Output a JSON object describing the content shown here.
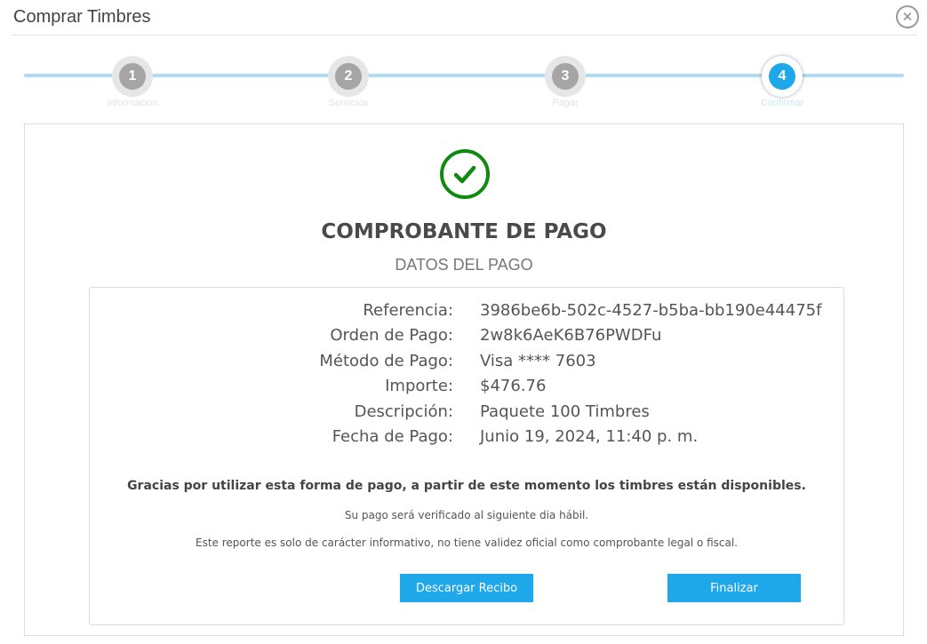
{
  "window": {
    "title": "Comprar Timbres",
    "close_icon": "close-icon"
  },
  "stepper": {
    "steps": [
      {
        "number": "1",
        "label": "Informacion",
        "active": false
      },
      {
        "number": "2",
        "label": "Servicios",
        "active": false
      },
      {
        "number": "3",
        "label": "Pagar",
        "active": false
      },
      {
        "number": "4",
        "label": "Confirmar",
        "active": true
      }
    ],
    "colors": {
      "line": "#aedcf6",
      "active": "#1ea7e9",
      "inactive": "#a5a5a5"
    }
  },
  "receipt": {
    "icon": "check-circle-icon",
    "icon_color": "#0f8a0f",
    "title": "COMPROBANTE DE PAGO",
    "subtitle": "DATOS DEL PAGO",
    "details": [
      {
        "label": "Referencia:",
        "value": "3986be6b-502c-4527-b5ba-bb190e44475f"
      },
      {
        "label": "Orden de Pago:",
        "value": "2w8k6AeK6B76PWDFu"
      },
      {
        "label": "Método de Pago:",
        "value": "Visa **** 7603"
      },
      {
        "label": "Importe:",
        "value": "$476.76"
      },
      {
        "label": "Descripción:",
        "value": "Paquete 100 Timbres"
      },
      {
        "label": "Fecha de Pago:",
        "value": "Junio 19, 2024, 11:40 p. m."
      }
    ],
    "thanks": "Gracias por utilizar esta forma de pago, a partir de este momento los timbres están disponibles.",
    "note_1": "Su pago será verificado al siguiente dia hábil.",
    "note_2": "Este reporte es solo de carácter informativo, no tiene validez oficial como comprobante legal o fiscal."
  },
  "actions": {
    "download_label": "Descargar Recibo",
    "finish_label": "Finalizar",
    "button_color": "#1ea7e9"
  }
}
